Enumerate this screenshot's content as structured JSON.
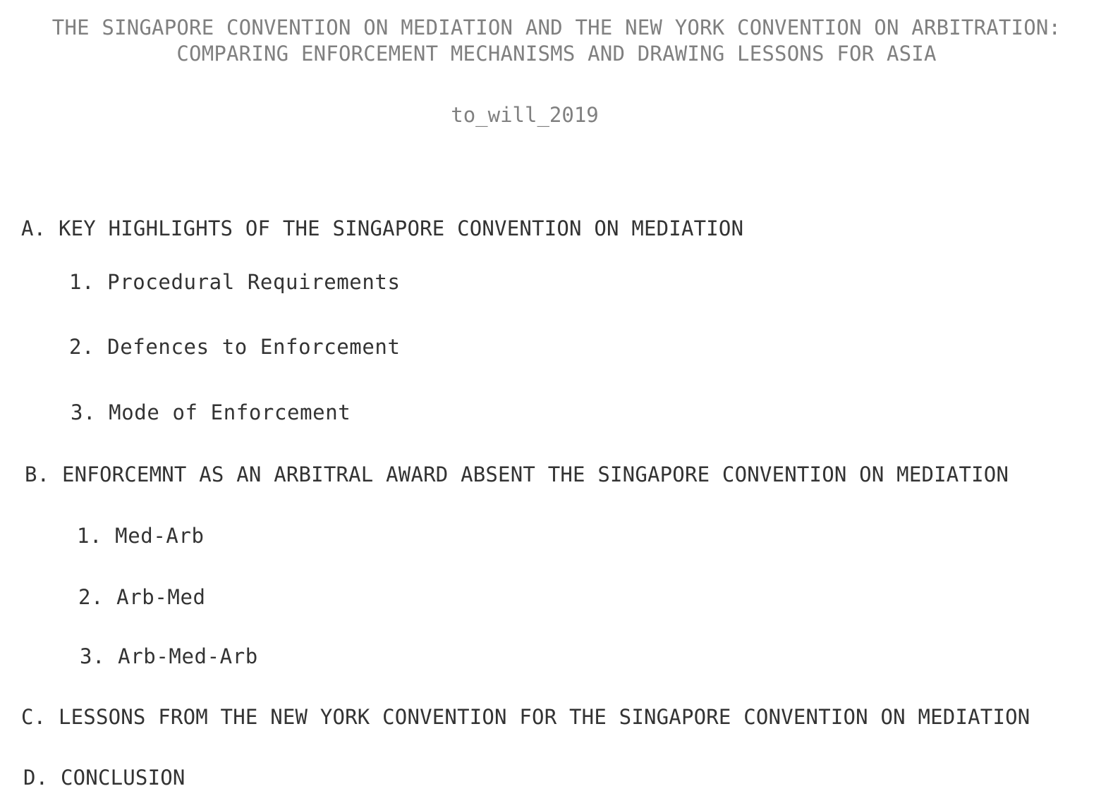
{
  "header": {
    "title_line1": "THE SINGAPORE CONVENTION ON MEDIATION AND THE NEW YORK CONVENTION ON ARBITRATION:",
    "title_line2": "COMPARING ENFORCEMENT MECHANISMS AND DRAWING LESSONS FOR ASIA",
    "author": "to_will_2019"
  },
  "outline": {
    "section_a": {
      "heading": "A. KEY HIGHLIGHTS OF THE SINGAPORE CONVENTION ON MEDIATION",
      "items": [
        "1. Procedural Requirements",
        "2. Defences to Enforcement",
        "3. Mode of Enforcement"
      ]
    },
    "section_b": {
      "heading": "B. ENFORCEMNT AS AN ARBITRAL AWARD ABSENT THE SINGAPORE CONVENTION ON MEDIATION",
      "items": [
        "1. Med-Arb",
        "2. Arb-Med",
        "3. Arb-Med-Arb"
      ]
    },
    "section_c": {
      "heading": "C. LESSONS FROM THE NEW YORK CONVENTION FOR THE SINGAPORE CONVENTION ON MEDIATION"
    },
    "section_d": {
      "heading": "D. CONCLUSION"
    }
  }
}
